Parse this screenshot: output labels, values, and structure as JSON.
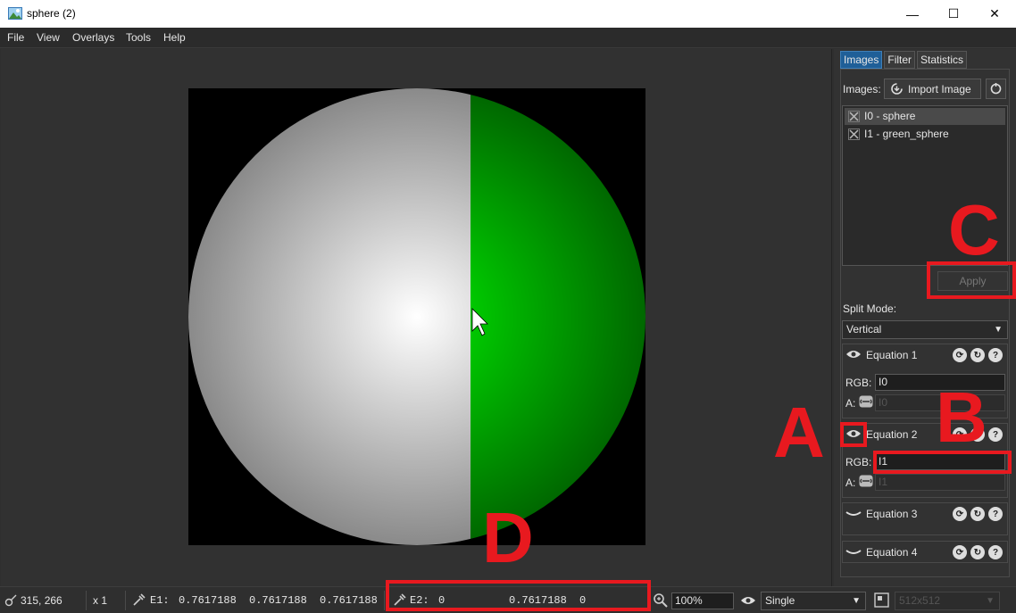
{
  "window": {
    "title": "sphere (2)",
    "minimize": "—",
    "maximize": "☐",
    "close": "✕"
  },
  "menu": [
    "File",
    "View",
    "Overlays",
    "Tools",
    "Help"
  ],
  "panel": {
    "tabs": [
      "Images",
      "Filter",
      "Statistics"
    ],
    "images_label": "Images:",
    "import_button": "Import Image",
    "images": [
      "I0 - sphere",
      "I1 - green_sphere"
    ],
    "apply_button": "Apply",
    "split_mode_label": "Split Mode:",
    "split_mode_value": "Vertical",
    "equations": [
      {
        "title": "Equation 1",
        "rgb_label": "RGB:",
        "rgb_value": "I0",
        "a_label": "A:",
        "a_value": "I0"
      },
      {
        "title": "Equation 2",
        "rgb_label": "RGB:",
        "rgb_value": "I1",
        "a_label": "A:",
        "a_value": "I1"
      },
      {
        "title": "Equation 3"
      },
      {
        "title": "Equation 4"
      }
    ]
  },
  "status": {
    "coords": "315, 266",
    "pixel_scale": "x 1",
    "e1_label": "E1:",
    "e1_values": [
      "0.7617188",
      "0.7617188",
      "0.7617188"
    ],
    "e2_label": "E2:",
    "e2_values": [
      "0",
      "0.7617188",
      "0"
    ],
    "zoom": "100%",
    "display_mode": "Single",
    "resolution": "512x512"
  },
  "annotations": {
    "a": "A",
    "b": "B",
    "c": "C",
    "d": "D"
  },
  "colors": {
    "accent": "#1f5f98",
    "annotation": "#e8191f",
    "green": "#00c400"
  }
}
